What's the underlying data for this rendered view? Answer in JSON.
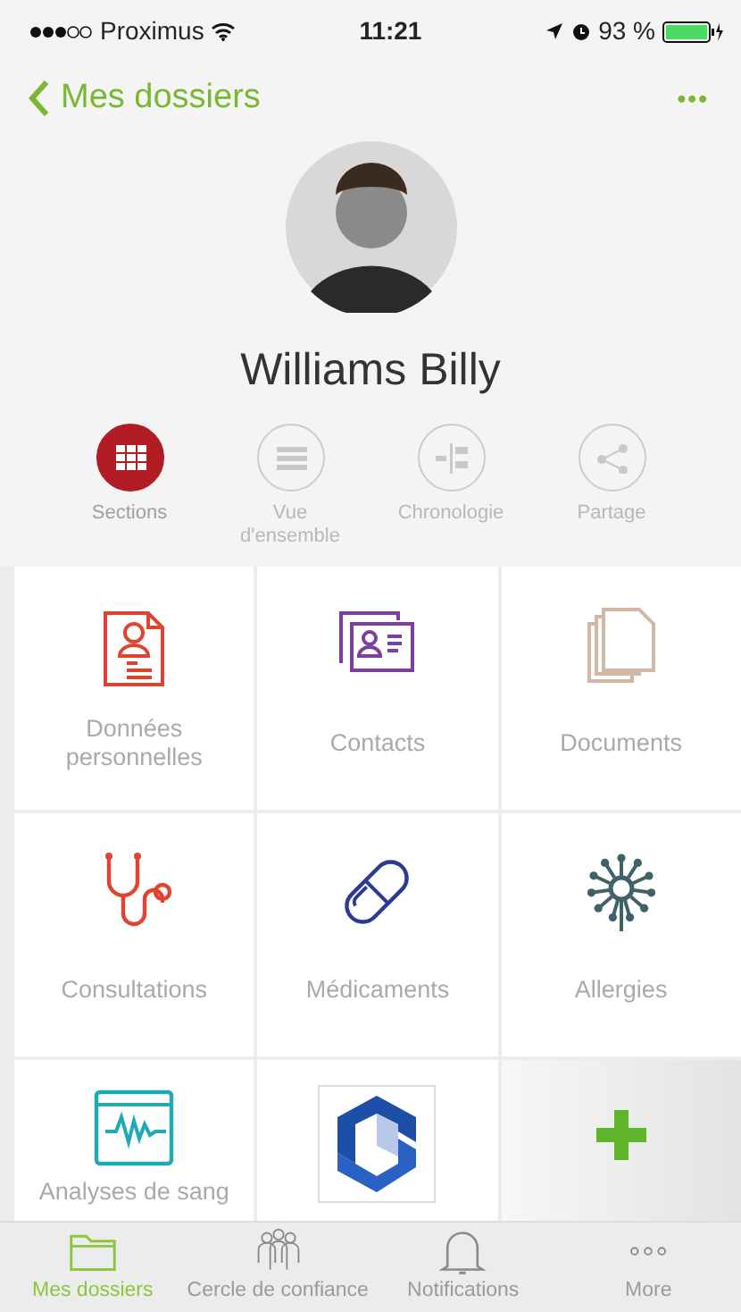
{
  "status_bar": {
    "carrier": "Proximus",
    "time": "11:21",
    "battery": "93 %"
  },
  "nav": {
    "back": "Mes dossiers",
    "menu": "•••"
  },
  "profile": {
    "name": "Williams Billy"
  },
  "views": [
    {
      "label": "Sections",
      "selected": true
    },
    {
      "label": "Vue d'ensemble",
      "selected": false
    },
    {
      "label": "Chronologie",
      "selected": false
    },
    {
      "label": "Partage",
      "selected": false
    }
  ],
  "sections": [
    {
      "kind": "section",
      "label": "Données personnelles"
    },
    {
      "kind": "section",
      "label": "Contacts"
    },
    {
      "kind": "section",
      "label": "Documents"
    },
    {
      "kind": "section",
      "label": "Consultations"
    },
    {
      "kind": "section",
      "label": "Médicaments"
    },
    {
      "kind": "section",
      "label": "Allergies"
    },
    {
      "kind": "section",
      "label": "Analyses de sang"
    },
    {
      "kind": "app"
    },
    {
      "kind": "add"
    }
  ],
  "tab_bar": [
    {
      "label": "Mes dossiers",
      "selected": true
    },
    {
      "label": "Cercle de confiance",
      "selected": false
    },
    {
      "label": "Notifications",
      "selected": false
    },
    {
      "label": "More",
      "selected": false
    }
  ]
}
